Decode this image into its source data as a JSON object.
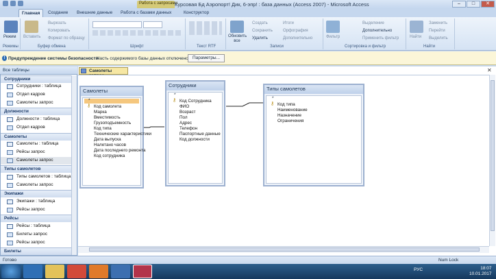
{
  "window": {
    "title": "Курсовая Бд Аэропорт! Дик, 6-эпр! : база данных (Access 2007) - Microsoft Access",
    "contextual_tab": "Работа с запросами"
  },
  "ribbon": {
    "tabs": [
      "Главная",
      "Создание",
      "Внешние данные",
      "Работа с базами данных",
      "Конструктор"
    ],
    "groups": {
      "views": "Режимы",
      "clipboard": "Буфер обмена",
      "font": "Шрифт",
      "rtf": "Текст RTF",
      "records": "Записи",
      "sort": "Сортировка и фильтр",
      "find": "Найти"
    },
    "buttons": {
      "view": "Режим",
      "paste": "Вставить",
      "cut": "Вырезать",
      "copy": "Копировать",
      "format_painter": "Формат по образцу",
      "refresh": "Обновить все",
      "new": "Создать",
      "save": "Сохранить",
      "delete": "Удалить",
      "totals": "Итоги",
      "spelling": "Орфография",
      "more": "Дополнительно",
      "filter": "Фильтр",
      "selection": "Выделение",
      "advanced": "Дополнительно",
      "toggle_filter": "Применить фильтр",
      "find": "Найти",
      "replace": "Заменить",
      "goto": "Перейти",
      "select": "Выделить"
    }
  },
  "security": {
    "title": "Предупреждение системы безопасности",
    "message": "Часть содержимого базы данных отключено",
    "button": "Параметры..."
  },
  "nav": {
    "header": "Все таблицы",
    "groups": [
      {
        "name": "Сотрудники",
        "items": [
          "Сотрудники : таблица",
          "Отдел кадров",
          "Самолеты запрос"
        ]
      },
      {
        "name": "Должности",
        "items": [
          "Должности : таблица",
          "Отдел кадров"
        ]
      },
      {
        "name": "Самолеты",
        "items": [
          "Самолеты : таблица",
          "Рейсы запрос",
          "Самолеты запрос"
        ]
      },
      {
        "name": "Типы самолетов",
        "items": [
          "Типы самолетов : таблица",
          "Самолеты запрос"
        ]
      },
      {
        "name": "Экипажи",
        "items": [
          "Экипажи : таблица",
          "Рейсы запрос"
        ]
      },
      {
        "name": "Рейсы",
        "items": [
          "Рейсы : таблица",
          "Билеты запрос",
          "Рейсы запрос"
        ]
      },
      {
        "name": "Билеты",
        "items": []
      }
    ]
  },
  "document": {
    "tab": "Самолеты запрос"
  },
  "tables": [
    {
      "name": "Самолеты",
      "fields": [
        "*",
        "Код самолета",
        "Марка",
        "Вместимость",
        "Грузоподъемность",
        "Код типа",
        "Технические характеристики",
        "Дата выпуска",
        "Налетано часов",
        "Дата последнего ремонта",
        "Код сотрудника"
      ],
      "key": "Код самолета"
    },
    {
      "name": "Сотрудники",
      "fields": [
        "*",
        "Код Сотрудника",
        "ФИО",
        "Возраст",
        "Пол",
        "Адрес",
        "Телефон",
        "Паспортные данные",
        "Код должности"
      ],
      "key": "Код Сотрудника"
    },
    {
      "name": "Типы самолетов",
      "fields": [
        "*",
        "Код типа",
        "Наименование",
        "Назначение",
        "Ограничения"
      ],
      "key": "Код типа"
    }
  ],
  "status": {
    "left": "Готово",
    "numlock": "Num Lock"
  },
  "taskbar": {
    "lang": "РУС",
    "time": "18:07",
    "date": "10.01.2017"
  }
}
